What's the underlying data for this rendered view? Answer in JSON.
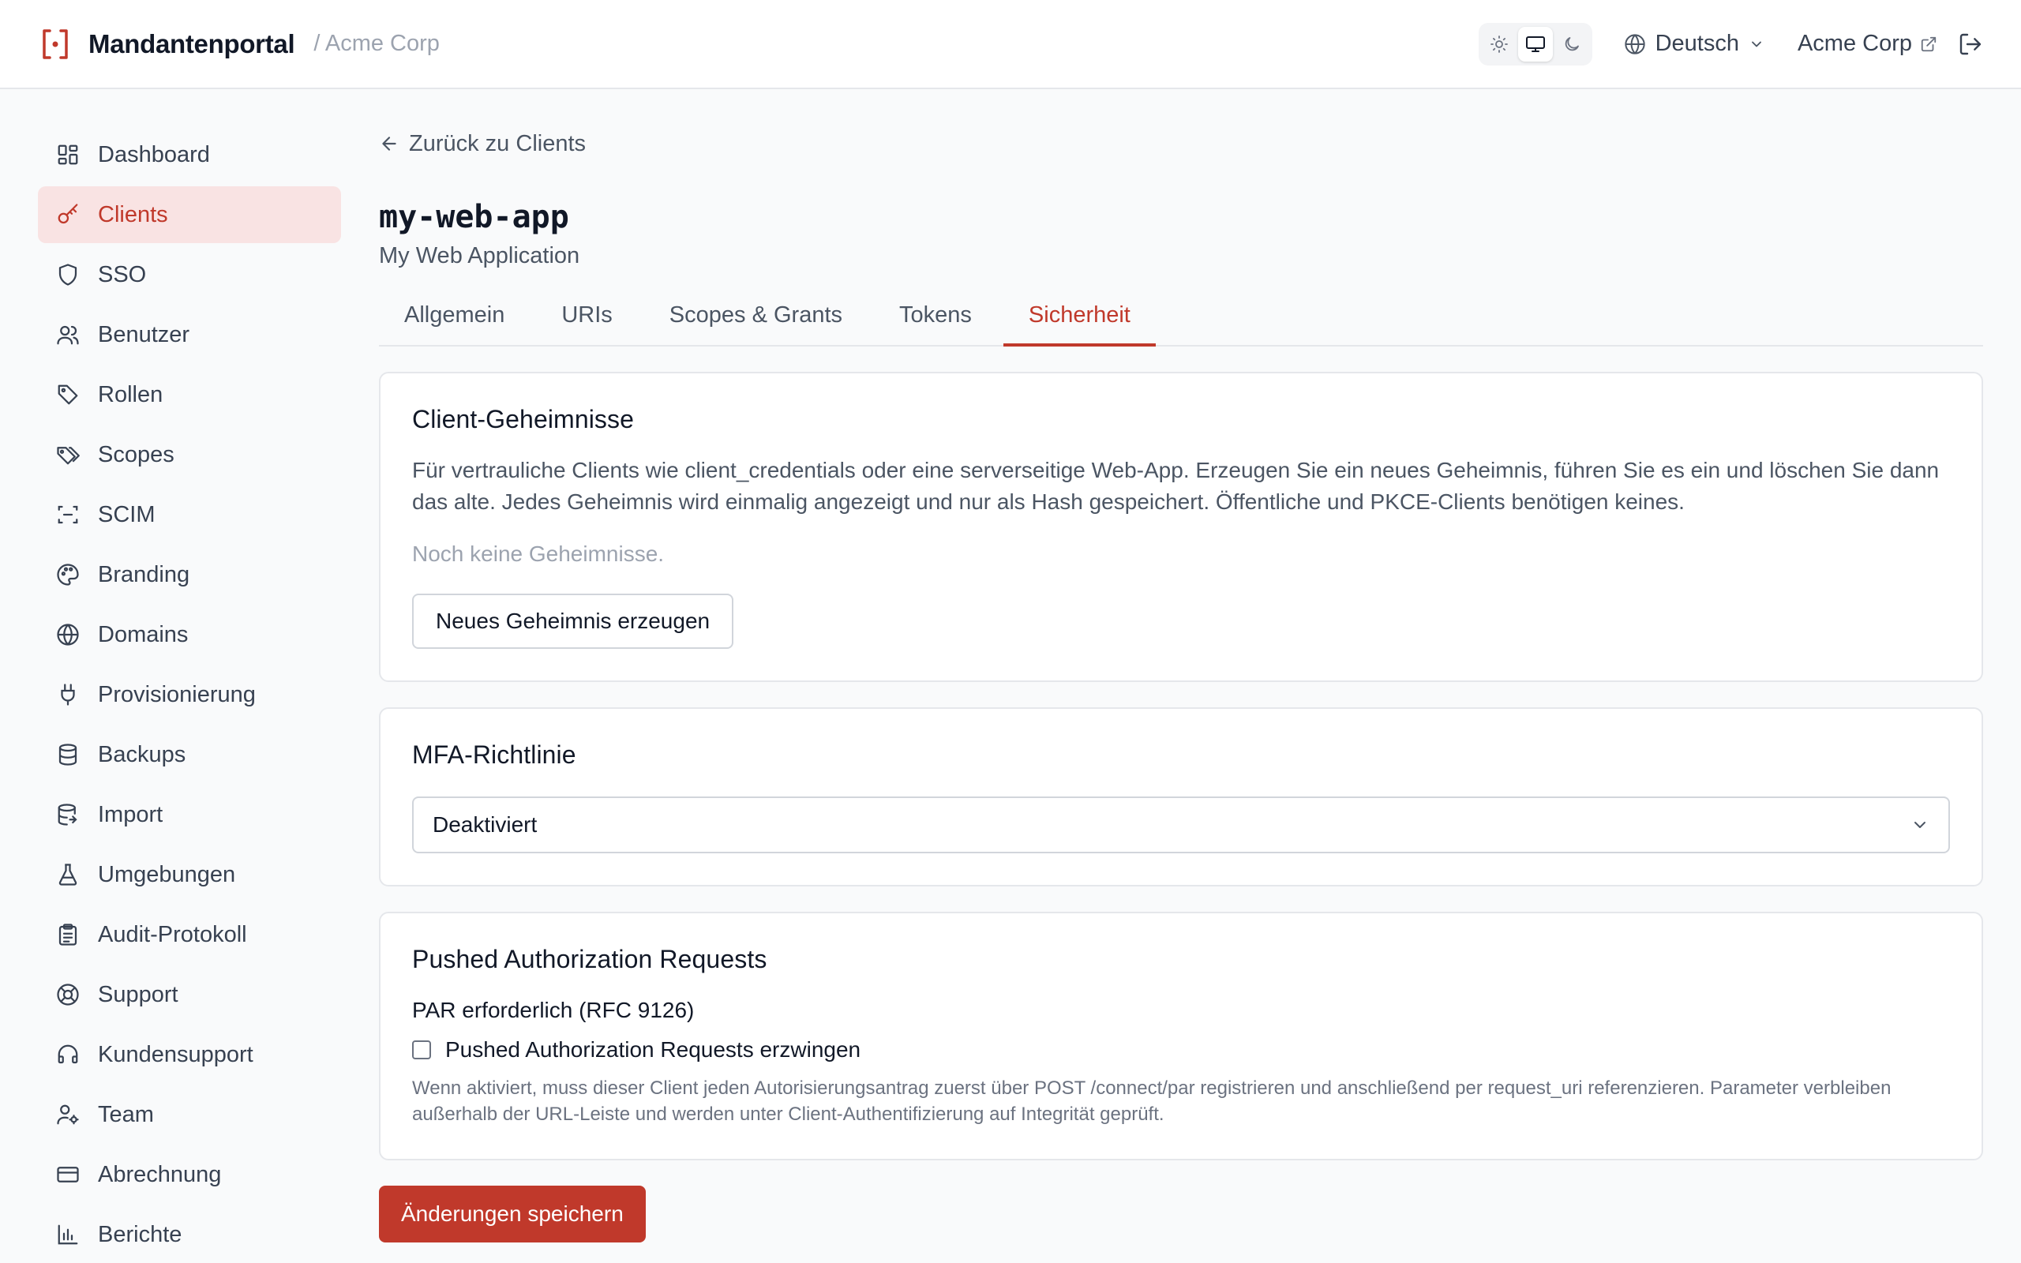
{
  "header": {
    "brand": "Mandantenportal",
    "crumb": "/ Acme Corp",
    "theme": {
      "light_icon": "sun-icon",
      "system_icon": "monitor-icon",
      "dark_icon": "moon-icon",
      "active": "system"
    },
    "language": "Deutsch",
    "tenant": "Acme Corp"
  },
  "sidebar": {
    "items": [
      {
        "label": "Dashboard",
        "icon": "dashboard-icon"
      },
      {
        "label": "Clients",
        "icon": "key-icon",
        "active": true
      },
      {
        "label": "SSO",
        "icon": "shield-icon"
      },
      {
        "label": "Benutzer",
        "icon": "users-icon"
      },
      {
        "label": "Rollen",
        "icon": "tag-icon"
      },
      {
        "label": "Scopes",
        "icon": "tags-icon"
      },
      {
        "label": "SCIM",
        "icon": "scan-icon"
      },
      {
        "label": "Branding",
        "icon": "palette-icon"
      },
      {
        "label": "Domains",
        "icon": "globe-icon"
      },
      {
        "label": "Provisionierung",
        "icon": "plug-icon"
      },
      {
        "label": "Backups",
        "icon": "database-icon"
      },
      {
        "label": "Import",
        "icon": "database-import-icon"
      },
      {
        "label": "Umgebungen",
        "icon": "flask-icon"
      },
      {
        "label": "Audit-Protokoll",
        "icon": "clipboard-icon"
      },
      {
        "label": "Support",
        "icon": "lifebuoy-icon"
      },
      {
        "label": "Kundensupport",
        "icon": "headset-icon"
      },
      {
        "label": "Team",
        "icon": "user-cog-icon"
      },
      {
        "label": "Abrechnung",
        "icon": "credit-card-icon"
      },
      {
        "label": "Berichte",
        "icon": "bar-chart-icon"
      }
    ]
  },
  "main": {
    "back_label": "Zurück zu Clients",
    "client_id": "my-web-app",
    "client_name": "My Web Application",
    "tabs": [
      {
        "label": "Allgemein"
      },
      {
        "label": "URIs"
      },
      {
        "label": "Scopes & Grants"
      },
      {
        "label": "Tokens"
      },
      {
        "label": "Sicherheit",
        "active": true
      }
    ],
    "secrets": {
      "title": "Client-Geheimnisse",
      "description": "Für vertrauliche Clients wie client_credentials oder eine serverseitige Web-App. Erzeugen Sie ein neues Geheimnis, führen Sie es ein und löschen Sie dann das alte. Jedes Geheimnis wird einmalig angezeigt und nur als Hash gespeichert. Öffentliche und PKCE-Clients benötigen keines.",
      "empty": "Noch keine Geheimnisse.",
      "button": "Neues Geheimnis erzeugen"
    },
    "mfa": {
      "title": "MFA-Richtlinie",
      "selected": "Deaktiviert"
    },
    "par": {
      "title": "Pushed Authorization Requests",
      "field_label": "PAR erforderlich (RFC 9126)",
      "checkbox_label": "Pushed Authorization Requests erzwingen",
      "checked": false,
      "help": "Wenn aktiviert, muss dieser Client jeden Autorisierungsantrag zuerst über POST /connect/par registrieren und anschließend per request_uri referenzieren. Parameter verbleiben außerhalb der URL-Leiste und werden unter Client-Authentifizierung auf Integrität geprüft."
    },
    "save_label": "Änderungen speichern"
  },
  "colors": {
    "accent": "#c0392b",
    "active_bg": "#f9e3e3"
  }
}
